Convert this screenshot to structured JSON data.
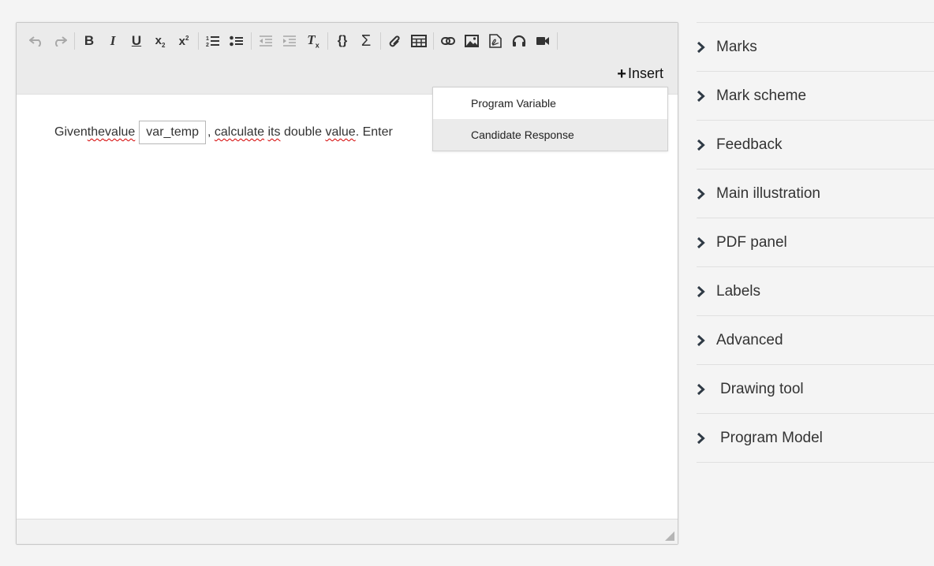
{
  "editor": {
    "toolbar": {
      "buttons": [
        {
          "name": "undo-icon",
          "glyph": "↶",
          "disabled": true
        },
        {
          "name": "redo-icon",
          "glyph": "↷",
          "disabled": true
        },
        {
          "sep": true
        },
        {
          "name": "bold-icon",
          "glyph": "B"
        },
        {
          "name": "italic-icon",
          "glyph": "I"
        },
        {
          "name": "underline-icon",
          "glyph": "U"
        },
        {
          "name": "subscript-icon",
          "glyph": "x₂"
        },
        {
          "name": "superscript-icon",
          "glyph": "x²"
        },
        {
          "sep": true
        },
        {
          "name": "numbered-list-icon",
          "glyph": "ol"
        },
        {
          "name": "bulleted-list-icon",
          "glyph": "ul"
        },
        {
          "sep": true
        },
        {
          "name": "outdent-icon",
          "glyph": "out",
          "disabled": true
        },
        {
          "name": "indent-icon",
          "glyph": "in",
          "disabled": true
        },
        {
          "name": "clear-format-icon",
          "glyph": "Tx"
        },
        {
          "sep": true
        },
        {
          "name": "code-braces-icon",
          "glyph": "{}"
        },
        {
          "name": "sigma-icon",
          "glyph": "Σ"
        },
        {
          "sep": true
        },
        {
          "name": "attachment-icon",
          "glyph": "clip"
        },
        {
          "name": "table-icon",
          "glyph": "tbl"
        },
        {
          "sep": true
        },
        {
          "name": "link-icon",
          "glyph": "link"
        },
        {
          "name": "image-icon",
          "glyph": "img"
        },
        {
          "name": "pdf-icon",
          "glyph": "pdf"
        },
        {
          "name": "audio-icon",
          "glyph": "aud"
        },
        {
          "name": "video-icon",
          "glyph": "vid"
        },
        {
          "sep": true
        }
      ],
      "insert_label": "Insert"
    },
    "content": {
      "text_before_1": "Given ",
      "word_the": "the",
      "text_space": " ",
      "word_value": "value",
      "variable": "var_temp",
      "text_comma": ", ",
      "word_calculate": "calculate",
      "word_its": "its",
      "text_double": " double ",
      "word_value2": "value",
      "text_enter": ". Enter"
    },
    "insert_menu": {
      "items": [
        {
          "label": "Program Variable",
          "hover": false
        },
        {
          "label": "Candidate Response",
          "hover": true
        }
      ]
    }
  },
  "panel": {
    "items": [
      {
        "label": "Marks"
      },
      {
        "label": "Mark scheme"
      },
      {
        "label": "Feedback"
      },
      {
        "label": "Main illustration"
      },
      {
        "label": "PDF panel"
      },
      {
        "label": "Labels"
      },
      {
        "label": "Advanced"
      },
      {
        "label": "Drawing tool"
      },
      {
        "label": "Program Model"
      }
    ]
  }
}
